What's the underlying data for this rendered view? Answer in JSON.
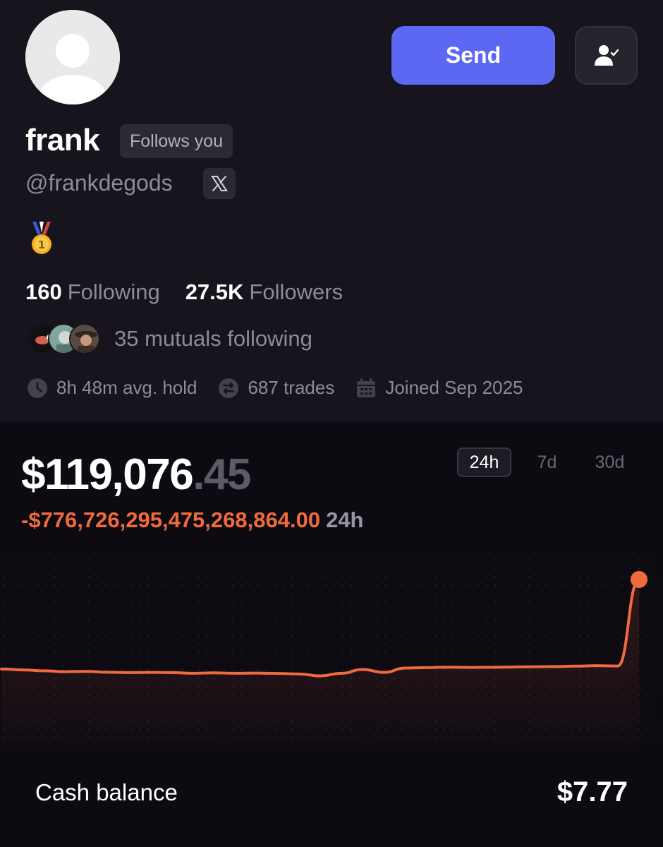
{
  "profile": {
    "name": "frank",
    "follows_badge": "Follows you",
    "handle": "@frankdegods",
    "send_label": "Send",
    "medal_icon": "gold-medal-icon",
    "following_count": "160",
    "following_label": "Following",
    "followers_count": "27.5K",
    "followers_label": "Followers",
    "mutuals_text": "35 mutuals following",
    "avg_hold": "8h 48m avg. hold",
    "trades": "687 trades",
    "joined": "Joined Sep 2025"
  },
  "portfolio": {
    "value_main": "$119,076",
    "value_cents": ".45",
    "change": "-$776,726,295,475,268,864.00",
    "change_period": "24h",
    "ranges": [
      {
        "label": "24h",
        "active": true
      },
      {
        "label": "7d",
        "active": false
      },
      {
        "label": "30d",
        "active": false
      }
    ],
    "cash_label": "Cash balance",
    "cash_value": "$7.77"
  },
  "colors": {
    "accent": "#5c67f2",
    "negative": "#f06a3d",
    "line": "#f06a3d"
  },
  "chart_data": {
    "type": "line",
    "title": "",
    "xlabel": "",
    "ylabel": "",
    "x": [
      0,
      1,
      2,
      3,
      4,
      5,
      6,
      7,
      8,
      9,
      10,
      11,
      12,
      13,
      14,
      15,
      16,
      17,
      18,
      19,
      20,
      21,
      22,
      23,
      24,
      25,
      26,
      27,
      28,
      29,
      30
    ],
    "series": [
      {
        "values": [
          0.385,
          0.378,
          0.372,
          0.366,
          0.368,
          0.362,
          0.36,
          0.361,
          0.36,
          0.355,
          0.358,
          0.355,
          0.356,
          0.354,
          0.35,
          0.337,
          0.355,
          0.381,
          0.361,
          0.391,
          0.394,
          0.397,
          0.395,
          0.396,
          0.398,
          0.4,
          0.401,
          0.404,
          0.407,
          0.405,
          1.0
        ]
      }
    ],
    "grid": false,
    "legend": "none"
  }
}
